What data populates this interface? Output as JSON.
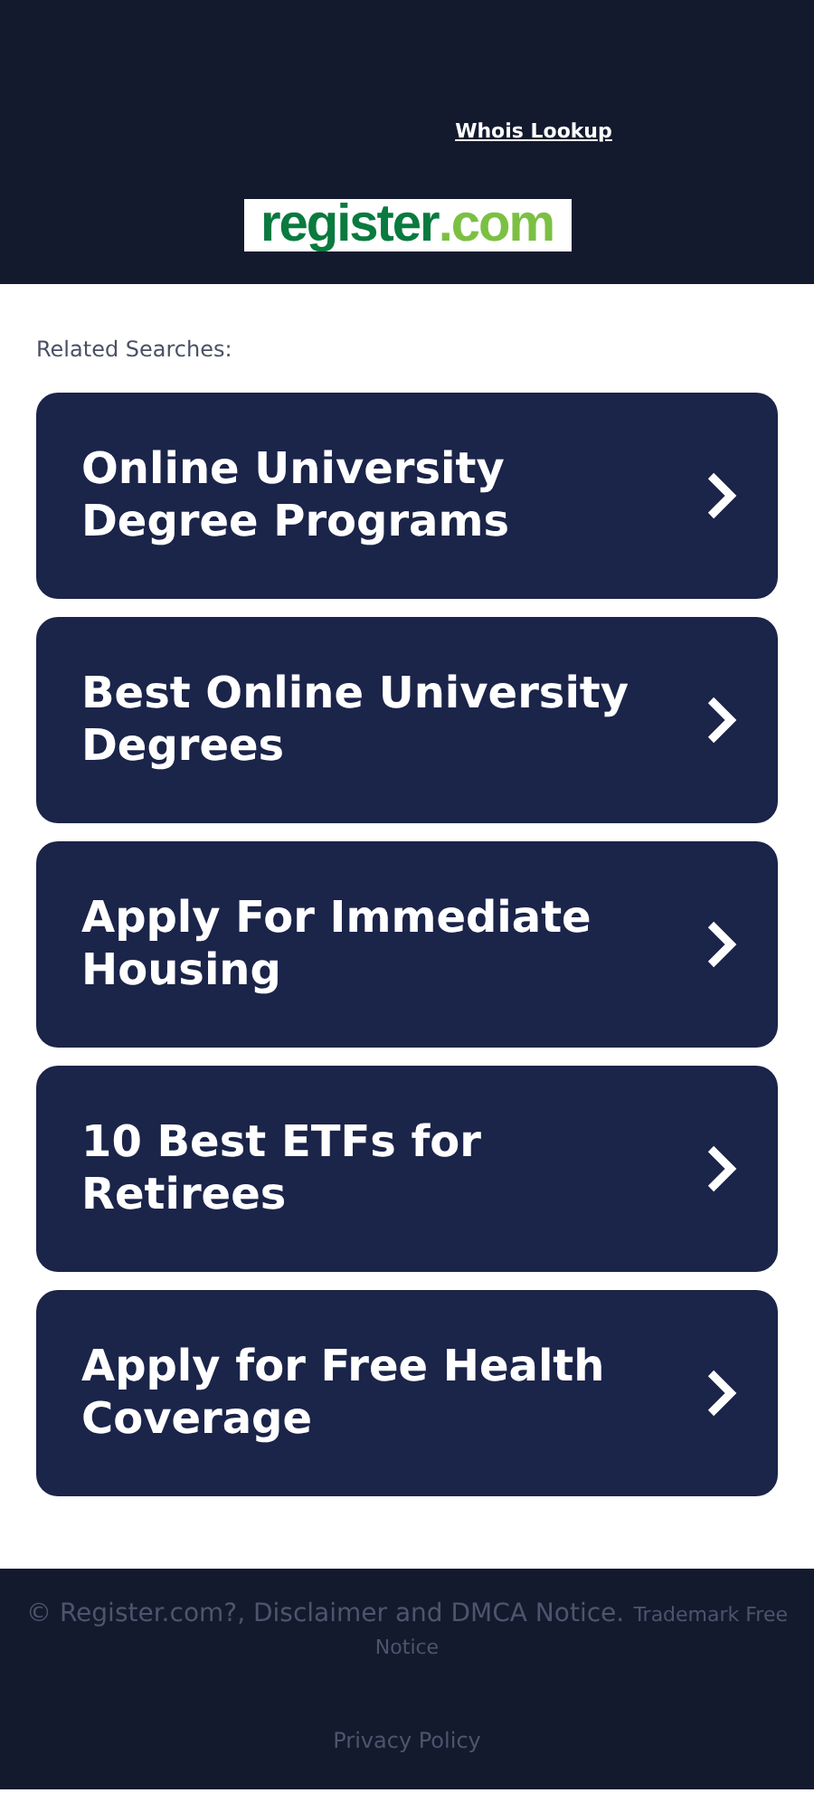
{
  "header": {
    "whois_link": "Whois Lookup",
    "logo": {
      "name": "register",
      "suffix": ".com"
    }
  },
  "related": {
    "title": "Related Searches:",
    "items": [
      {
        "label": "Online University Degree Programs"
      },
      {
        "label": "Best Online University Degrees"
      },
      {
        "label": "Apply For Immediate Housing"
      },
      {
        "label": "10 Best ETFs for Retirees"
      },
      {
        "label": "Apply for Free Health Coverage"
      }
    ]
  },
  "footer": {
    "copyright": "© Register.com?, Disclaimer and DMCA Notice.",
    "trademark": "Trademark Free Notice",
    "privacy_link": "Privacy Policy"
  }
}
